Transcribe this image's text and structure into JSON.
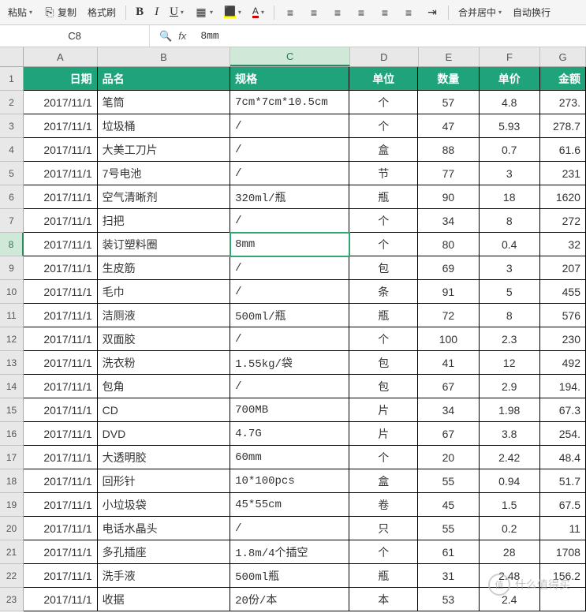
{
  "toolbar": {
    "paste": "粘贴",
    "copy": "复制",
    "format_painter": "格式刷",
    "merge_center": "合并居中",
    "wrap_text": "自动换行"
  },
  "namebox": "C8",
  "formula": "8mm",
  "columns": [
    "A",
    "B",
    "C",
    "D",
    "E",
    "F",
    "G"
  ],
  "active_col": "C",
  "active_row": 8,
  "headers": {
    "date": "日期",
    "name": "品名",
    "spec": "规格",
    "unit": "单位",
    "qty": "数量",
    "price": "单价",
    "amount": "金额"
  },
  "rows": [
    {
      "n": 1,
      "date": "",
      "name": "",
      "spec": "",
      "unit": "",
      "qty": "",
      "price": "",
      "amount": "",
      "is_header": true
    },
    {
      "n": 2,
      "date": "2017/11/1",
      "name": "笔筒",
      "spec": "7cm*7cm*10.5cm",
      "unit": "个",
      "qty": "57",
      "price": "4.8",
      "amount": "273."
    },
    {
      "n": 3,
      "date": "2017/11/1",
      "name": "垃圾桶",
      "spec": "/",
      "unit": "个",
      "qty": "47",
      "price": "5.93",
      "amount": "278.7"
    },
    {
      "n": 4,
      "date": "2017/11/1",
      "name": "大美工刀片",
      "spec": "/",
      "unit": "盒",
      "qty": "88",
      "price": "0.7",
      "amount": "61.6"
    },
    {
      "n": 5,
      "date": "2017/11/1",
      "name": "7号电池",
      "spec": "/",
      "unit": "节",
      "qty": "77",
      "price": "3",
      "amount": "231"
    },
    {
      "n": 6,
      "date": "2017/11/1",
      "name": "空气清晰剂",
      "spec": "320ml/瓶",
      "unit": "瓶",
      "qty": "90",
      "price": "18",
      "amount": "1620"
    },
    {
      "n": 7,
      "date": "2017/11/1",
      "name": "扫把",
      "spec": "/",
      "unit": "个",
      "qty": "34",
      "price": "8",
      "amount": "272"
    },
    {
      "n": 8,
      "date": "2017/11/1",
      "name": "装订塑料圈",
      "spec": "8mm",
      "unit": "个",
      "qty": "80",
      "price": "0.4",
      "amount": "32"
    },
    {
      "n": 9,
      "date": "2017/11/1",
      "name": "生皮筋",
      "spec": "/",
      "unit": "包",
      "qty": "69",
      "price": "3",
      "amount": "207"
    },
    {
      "n": 10,
      "date": "2017/11/1",
      "name": "毛巾",
      "spec": "/",
      "unit": "条",
      "qty": "91",
      "price": "5",
      "amount": "455"
    },
    {
      "n": 11,
      "date": "2017/11/1",
      "name": "洁厕液",
      "spec": "500ml/瓶",
      "unit": "瓶",
      "qty": "72",
      "price": "8",
      "amount": "576"
    },
    {
      "n": 12,
      "date": "2017/11/1",
      "name": "双面胶",
      "spec": "/",
      "unit": "个",
      "qty": "100",
      "price": "2.3",
      "amount": "230"
    },
    {
      "n": 13,
      "date": "2017/11/1",
      "name": "洗衣粉",
      "spec": "1.55kg/袋",
      "unit": "包",
      "qty": "41",
      "price": "12",
      "amount": "492"
    },
    {
      "n": 14,
      "date": "2017/11/1",
      "name": "包角",
      "spec": "/",
      "unit": "包",
      "qty": "67",
      "price": "2.9",
      "amount": "194."
    },
    {
      "n": 15,
      "date": "2017/11/1",
      "name": "CD",
      "spec": "700MB",
      "unit": "片",
      "qty": "34",
      "price": "1.98",
      "amount": "67.3"
    },
    {
      "n": 16,
      "date": "2017/11/1",
      "name": "DVD",
      "spec": "4.7G",
      "unit": "片",
      "qty": "67",
      "price": "3.8",
      "amount": "254."
    },
    {
      "n": 17,
      "date": "2017/11/1",
      "name": "大透明胶",
      "spec": "60mm",
      "unit": "个",
      "qty": "20",
      "price": "2.42",
      "amount": "48.4"
    },
    {
      "n": 18,
      "date": "2017/11/1",
      "name": "回形针",
      "spec": "10*100pcs",
      "unit": "盒",
      "qty": "55",
      "price": "0.94",
      "amount": "51.7"
    },
    {
      "n": 19,
      "date": "2017/11/1",
      "name": "小垃圾袋",
      "spec": "45*55cm",
      "unit": "卷",
      "qty": "45",
      "price": "1.5",
      "amount": "67.5"
    },
    {
      "n": 20,
      "date": "2017/11/1",
      "name": "电话水晶头",
      "spec": "/",
      "unit": "只",
      "qty": "55",
      "price": "0.2",
      "amount": "11"
    },
    {
      "n": 21,
      "date": "2017/11/1",
      "name": "多孔插座",
      "spec": "1.8m/4个插空",
      "unit": "个",
      "qty": "61",
      "price": "28",
      "amount": "1708"
    },
    {
      "n": 22,
      "date": "2017/11/1",
      "name": "洗手液",
      "spec": "500ml瓶",
      "unit": "瓶",
      "qty": "31",
      "price": "2.48",
      "amount": "156.2"
    },
    {
      "n": 23,
      "date": "2017/11/1",
      "name": "收据",
      "spec": "20份/本",
      "unit": "本",
      "qty": "53",
      "price": "2.4",
      "amount": ""
    }
  ],
  "watermark": "什么值得买"
}
